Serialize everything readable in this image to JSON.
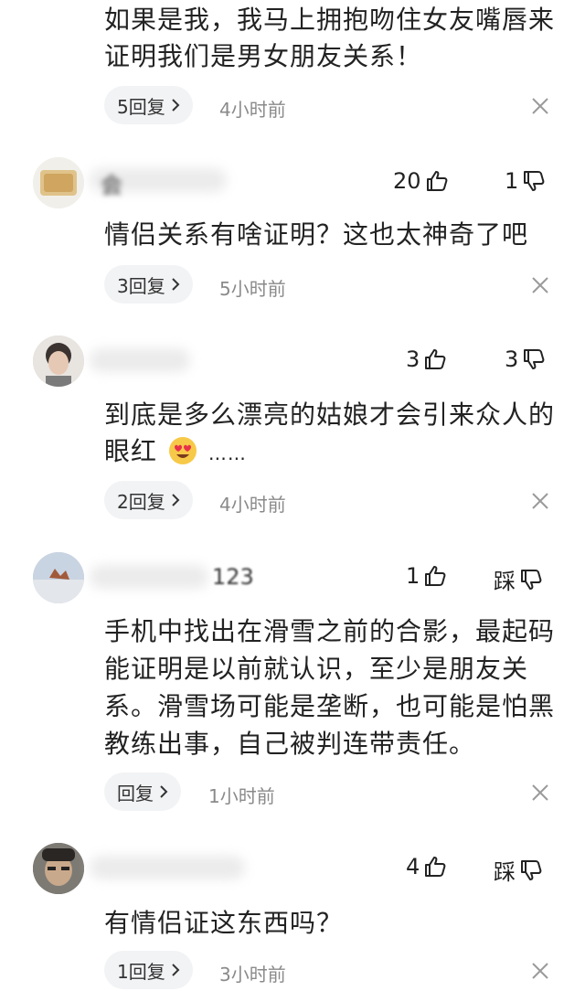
{
  "comments": [
    {
      "text": "如果是我，我马上拥抱吻住女友嘴唇来证明我们是男女朋友关系！",
      "reply_label": "5回复",
      "time": "4小时前"
    },
    {
      "name": "会",
      "like_count": "20",
      "dislike_count": "1",
      "text": "情侣关系有啥证明？这也太神奇了吧",
      "reply_label": "3回复",
      "time": "5小时前"
    },
    {
      "like_count": "3",
      "dislike_count": "3",
      "text": "到底是多么漂亮的姑娘才会引来众人的眼红",
      "text_tail": "……",
      "reply_label": "2回复",
      "time": "4小时前"
    },
    {
      "name": "123",
      "like_count": "1",
      "dislike_count": "踩",
      "text": "手机中找出在滑雪之前的合影，最起码能证明是以前就认识，至少是朋友关系。滑雪场可能是垄断，也可能是怕黑教练出事，自己被判连带责任。",
      "reply_label": "回复",
      "time": "1小时前"
    },
    {
      "like_count": "4",
      "dislike_count": "踩",
      "text": "有情侣证这东西吗？",
      "reply_label": "1回复",
      "time": "3小时前"
    }
  ],
  "icons": {
    "like": "thumb-up-icon",
    "dislike": "thumb-down-icon",
    "chevron": "chevron-right-icon",
    "close": "close-icon",
    "emoji": "heart-eyes-emoji"
  }
}
